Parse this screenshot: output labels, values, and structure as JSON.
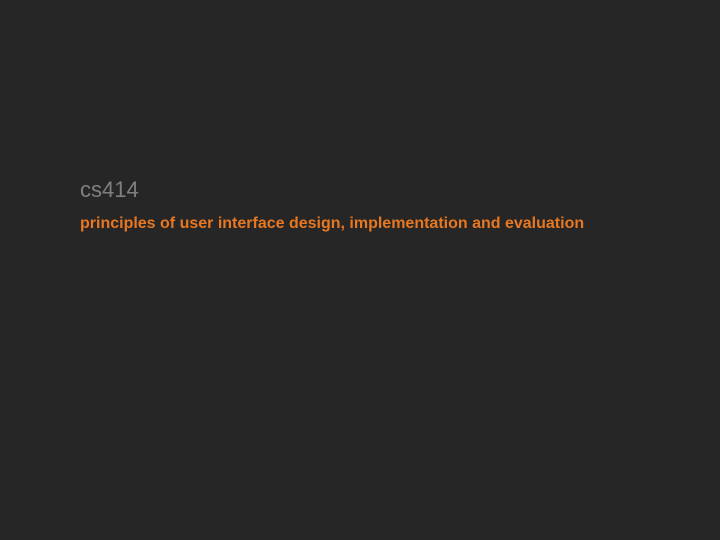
{
  "slide": {
    "course_code": "cs414",
    "course_title": "principles of user interface design, implementation and evaluation"
  }
}
